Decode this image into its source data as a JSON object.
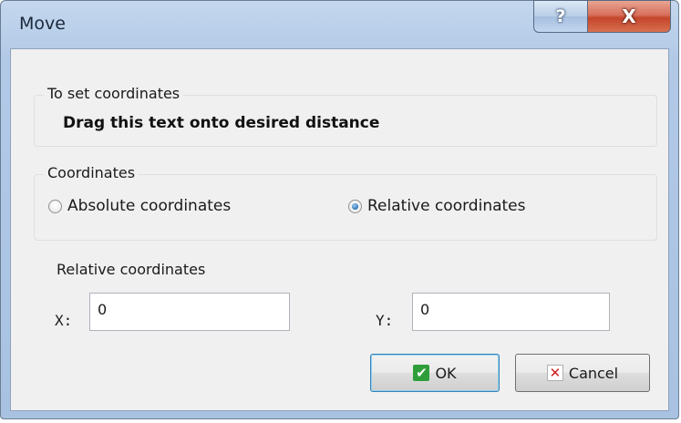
{
  "window": {
    "title": "Move",
    "help_glyph": "?",
    "close_glyph": "X"
  },
  "set_coordinates_group": {
    "label": "To set coordinates",
    "drag_text": "Drag this text onto desired distance"
  },
  "coordinates_group": {
    "label": "Coordinates",
    "options": [
      {
        "label": "Absolute coordinates",
        "checked": false
      },
      {
        "label": "Relative coordinates",
        "checked": true
      }
    ]
  },
  "relative_section": {
    "label": "Relative coordinates",
    "x_label": "X:",
    "x_value": "0",
    "y_label": "Y:",
    "y_value": "0"
  },
  "buttons": {
    "ok_label": "OK",
    "cancel_label": "Cancel",
    "ok_icon": "checkmark-icon",
    "cancel_icon": "x-mark-icon"
  },
  "colors": {
    "title_bar": "#b2c9e6",
    "close_button": "#c4452b",
    "dialog_background": "#f0f0f0",
    "ok_icon": "#2f9e3a",
    "cancel_icon": "#d22020"
  }
}
